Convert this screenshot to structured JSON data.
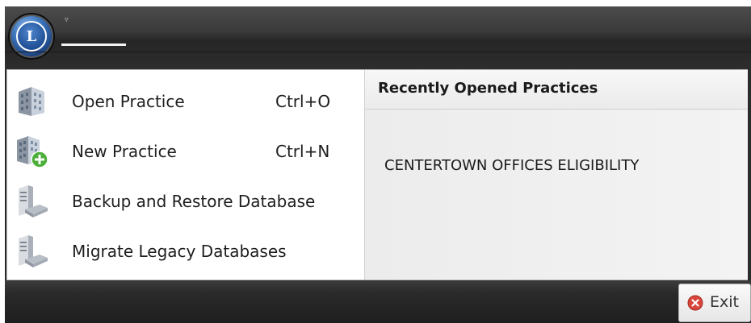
{
  "app": {
    "orb_letter": "L",
    "qat_dropdown": "▿"
  },
  "menu": {
    "items": [
      {
        "label": "Open Practice",
        "shortcut": "Ctrl+O",
        "icon": "building-icon"
      },
      {
        "label": "New Practice",
        "shortcut": "Ctrl+N",
        "icon": "building-add-icon"
      },
      {
        "label": "Backup and Restore Database",
        "shortcut": "",
        "icon": "server-icon"
      },
      {
        "label": "Migrate Legacy Databases",
        "shortcut": "",
        "icon": "server-icon"
      }
    ]
  },
  "recent": {
    "title": "Recently Opened Practices",
    "items": [
      "CENTERTOWN OFFICES ELIGIBILITY"
    ]
  },
  "footer": {
    "exit_label": "Exit",
    "exit_icon": "close-circle-icon"
  },
  "colors": {
    "ribbon_dark": "#2b2b2b",
    "orb_blue": "#1f4f95",
    "exit_red": "#d9453b",
    "add_green": "#4caf3a"
  }
}
